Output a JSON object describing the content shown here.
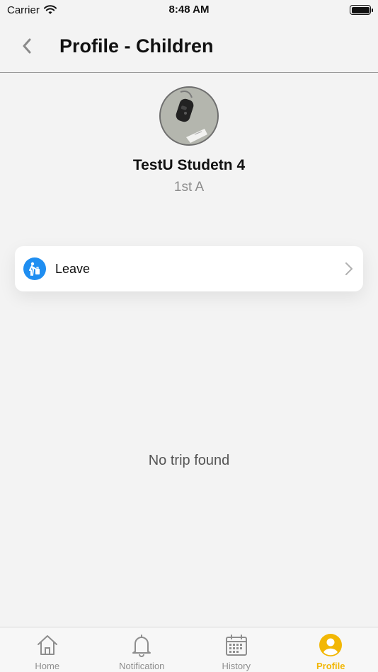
{
  "status_bar": {
    "carrier": "Carrier",
    "time": "8:48 AM"
  },
  "header": {
    "title": "Profile - Children"
  },
  "student": {
    "name": "TestU Studetn 4",
    "class": "1st A"
  },
  "leave_card": {
    "label": "Leave",
    "icon": "person-leaving-icon",
    "icon_color": "#1f8ef1"
  },
  "empty_state": {
    "message": "No trip found"
  },
  "tabs": [
    {
      "label": "Home",
      "icon": "home-icon",
      "active": false
    },
    {
      "label": "Notification",
      "icon": "bell-icon",
      "active": false
    },
    {
      "label": "History",
      "icon": "calendar-icon",
      "active": false
    },
    {
      "label": "Profile",
      "icon": "profile-icon",
      "active": true
    }
  ],
  "colors": {
    "accent": "#f2b705",
    "inactive": "#8e8e8e",
    "background": "#f3f3f3"
  }
}
